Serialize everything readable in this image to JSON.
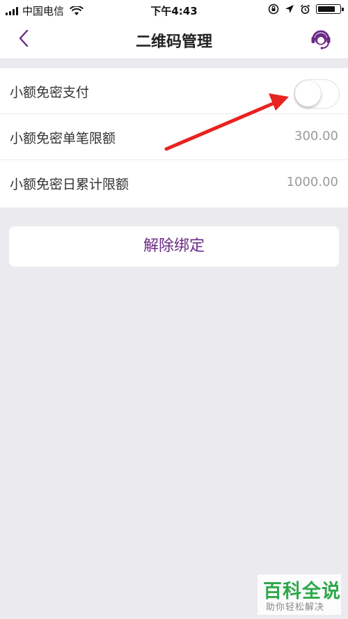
{
  "status_bar": {
    "carrier": "中国电信",
    "time": "下午4:43"
  },
  "nav": {
    "title": "二维码管理",
    "back_icon": "chevron-left-icon",
    "service_icon": "customer-service-icon"
  },
  "settings": [
    {
      "label": "小额免密支付",
      "type": "toggle",
      "enabled": false
    },
    {
      "label": "小额免密单笔限额",
      "value": "300.00"
    },
    {
      "label": "小额免密日累计限额",
      "value": "1000.00"
    }
  ],
  "unbind_button": {
    "label": "解除绑定"
  },
  "watermark": {
    "title": "百科全说",
    "subtitle": "助你轻松解决"
  },
  "colors": {
    "accent": "#6b2a87",
    "background": "#ebebef",
    "annotation_arrow": "#e8231f"
  }
}
